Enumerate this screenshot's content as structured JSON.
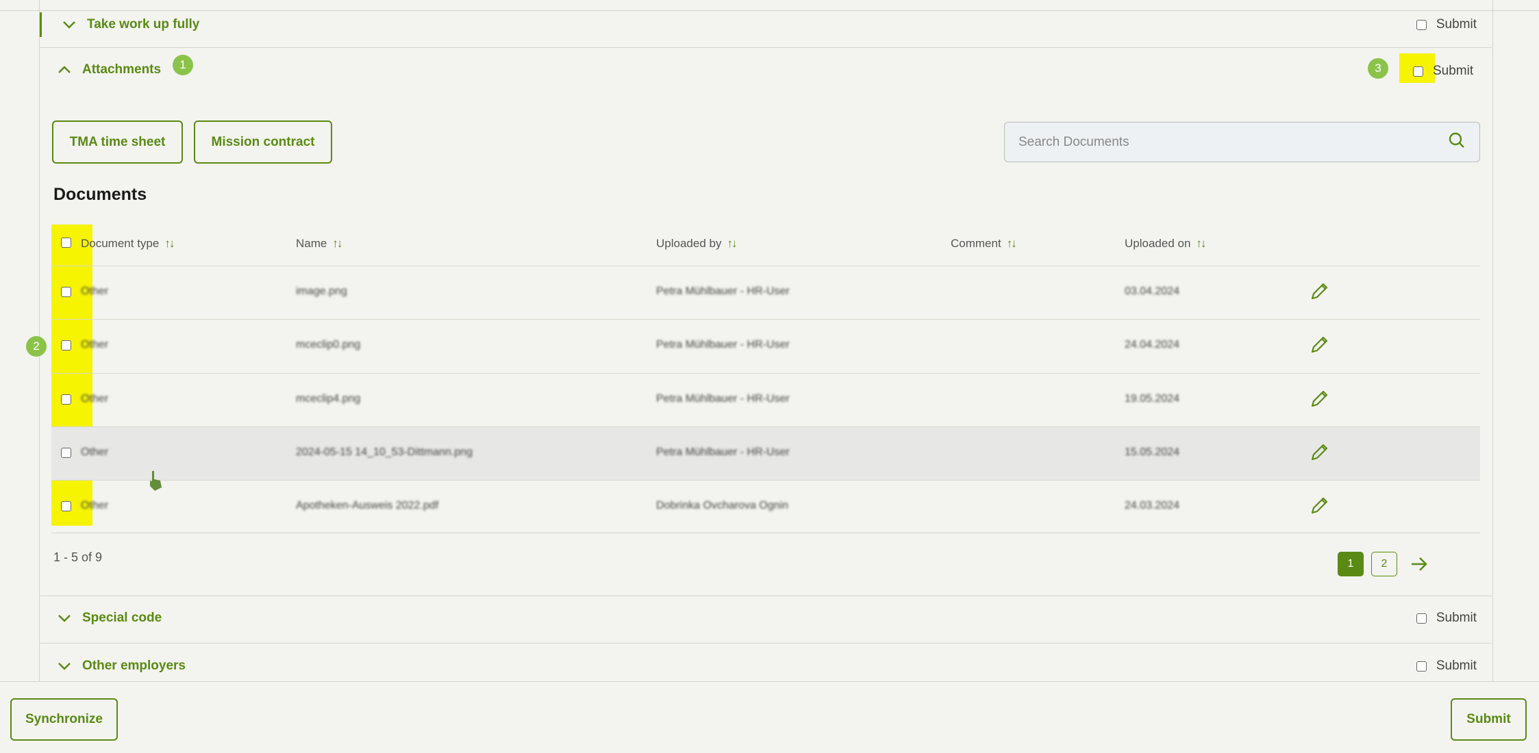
{
  "sections": {
    "take_work_up": {
      "title": "Take work up fully",
      "submit_label": "Submit"
    },
    "attachments": {
      "title": "Attachments",
      "submit_label": "Submit"
    },
    "special_code": {
      "title": "Special code",
      "submit_label": "Submit"
    },
    "other_employers": {
      "title": "Other employers",
      "submit_label": "Submit"
    }
  },
  "badges": {
    "b1": "1",
    "b2": "2",
    "b3": "3"
  },
  "attachment_buttons": {
    "tma": "TMA time sheet",
    "mission": "Mission contract"
  },
  "search": {
    "placeholder": "Search Documents"
  },
  "documents": {
    "title": "Documents",
    "columns": {
      "document_type": "Document type",
      "name": "Name",
      "uploaded_by": "Uploaded by",
      "comment": "Comment",
      "uploaded_on": "Uploaded on"
    },
    "rows": [
      {
        "type": "Other",
        "name": "image.png",
        "uploaded_by": "Petra Mühlbauer - HR-User",
        "comment": "",
        "uploaded_on": "03.04.2024"
      },
      {
        "type": "Other",
        "name": "mceclip0.png",
        "uploaded_by": "Petra Mühlbauer - HR-User",
        "comment": "",
        "uploaded_on": "24.04.2024"
      },
      {
        "type": "Other",
        "name": "mceclip4.png",
        "uploaded_by": "Petra Mühlbauer - HR-User",
        "comment": "",
        "uploaded_on": "19.05.2024"
      },
      {
        "type": "Other",
        "name": "2024-05-15 14_10_53-Dittmann.png",
        "uploaded_by": "Petra Mühlbauer - HR-User",
        "comment": "",
        "uploaded_on": "15.05.2024"
      },
      {
        "type": "Other",
        "name": "Apotheken-Ausweis 2022.pdf",
        "uploaded_by": "Dobrinka Ovcharova Ognin",
        "comment": "",
        "uploaded_on": "24.03.2024"
      }
    ]
  },
  "pagination": {
    "info": "1 - 5 of 9",
    "pages": [
      "1",
      "2"
    ],
    "current": "1"
  },
  "footer": {
    "synchronize": "Synchronize",
    "submit": "Submit"
  },
  "colors": {
    "accent": "#5a8a14",
    "badge": "#8bc34a",
    "highlight": "#f6f400",
    "background": "#f3f3ef"
  }
}
